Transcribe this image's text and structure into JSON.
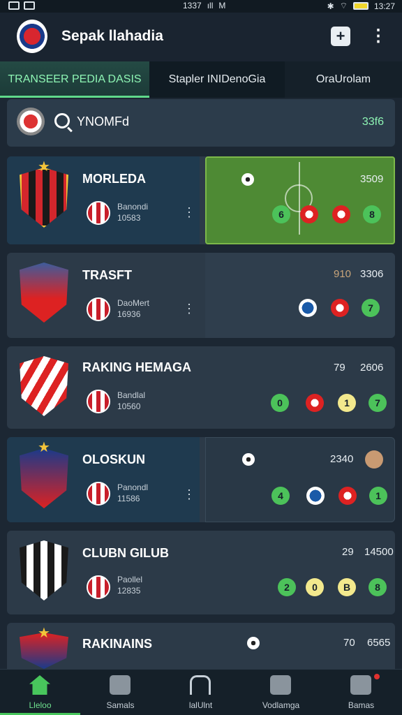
{
  "status_bar": {
    "time_left": "1337",
    "signal": "ıll",
    "carrier": "M",
    "time_right": "13:27"
  },
  "app": {
    "title": "Sepak llahadia",
    "add_icon": "add-icon",
    "menu_icon": "more-vertical-icon"
  },
  "tabs": [
    {
      "label": "TRANSEER PEDIA DASIS",
      "active": true
    },
    {
      "label": "Stapler INIDenoGia",
      "active": false
    },
    {
      "label": "OraUrolam",
      "active": false
    }
  ],
  "search": {
    "query": "YNOMFd",
    "count": "33f6"
  },
  "clubs": [
    {
      "name": "MORLEDA",
      "sub1": "Banondi",
      "sub2": "10583",
      "stat_a": "",
      "stat_b": "3509",
      "chips": [
        "6",
        "",
        "",
        "8"
      ]
    },
    {
      "name": "TRASFT",
      "sub1": "DaoMert",
      "sub2": "16936",
      "stat_a": "910",
      "stat_b": "3306",
      "chips": [
        "",
        "",
        "7"
      ]
    },
    {
      "name": "RAKING HEMAGA",
      "sub1": "Bandlal",
      "sub2": "10560",
      "stat_a": "79",
      "stat_b": "2606",
      "chips": [
        "0",
        "",
        "1",
        "7"
      ]
    },
    {
      "name": "OLOSKUN",
      "sub1": "Panondl",
      "sub2": "11586",
      "stat_a": "",
      "stat_b": "2340",
      "chips": [
        "4",
        "",
        "",
        "1"
      ]
    },
    {
      "name": "CLUBN GILUB",
      "sub1": "Paollel",
      "sub2": "12835",
      "stat_a": "29",
      "stat_b": "14500",
      "chips": [
        "2",
        "0",
        "B",
        "8"
      ]
    },
    {
      "name": "RAKINAINS",
      "sub1": "",
      "sub2": "",
      "stat_a": "70",
      "stat_b": "6565",
      "chips": []
    }
  ],
  "bottom_nav": [
    {
      "label": "Lleloo",
      "icon": "home-icon",
      "active": true
    },
    {
      "label": "Samals",
      "icon": "edit-icon",
      "active": false
    },
    {
      "label": "lalUlnt",
      "icon": "stadium-icon",
      "active": false
    },
    {
      "label": "Vodlamga",
      "icon": "profile-icon",
      "active": false
    },
    {
      "label": "Bamas",
      "icon": "notification-icon",
      "active": false
    }
  ]
}
